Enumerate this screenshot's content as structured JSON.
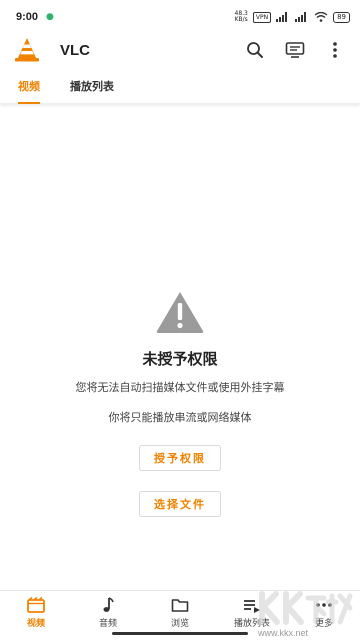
{
  "status_bar": {
    "time": "9:00",
    "net_speed_value": "48.3",
    "net_speed_unit": "KB/s",
    "vpn": "VPN",
    "battery": "89"
  },
  "app_bar": {
    "title": "VLC"
  },
  "tabs": [
    {
      "label": "视频",
      "active": true
    },
    {
      "label": "播放列表",
      "active": false
    }
  ],
  "empty_state": {
    "title": "未授予权限",
    "line1": "您将无法自动扫描媒体文件或使用外挂字幕",
    "line2": "你将只能播放串流或网络媒体",
    "grant_button": "授予权限",
    "choose_file_button": "选择文件"
  },
  "bottom_nav": [
    {
      "label": "视频",
      "icon": "video-icon",
      "active": true
    },
    {
      "label": "音频",
      "icon": "music-note-icon",
      "active": false
    },
    {
      "label": "浏览",
      "icon": "folder-icon",
      "active": false
    },
    {
      "label": "播放列表",
      "icon": "playlist-icon",
      "active": false
    },
    {
      "label": "更多",
      "icon": "more-icon",
      "active": false
    }
  ],
  "watermark": {
    "site": "www.kkx.net"
  },
  "colors": {
    "accent": "#f08300",
    "text": "#222222"
  }
}
